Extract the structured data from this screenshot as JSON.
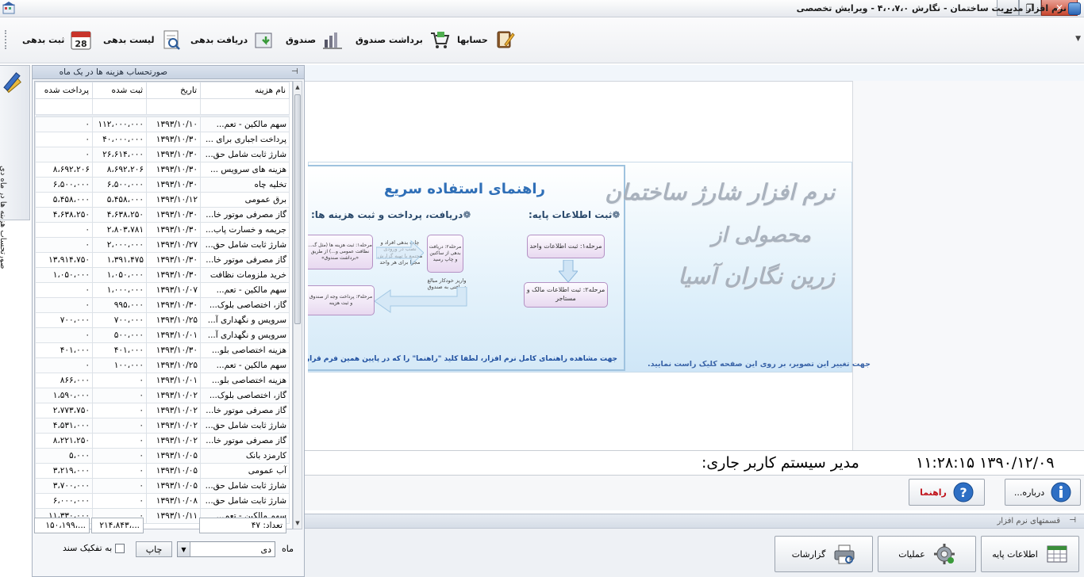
{
  "window": {
    "title": "نرم افزار مدیریت ساختمان - نگارش ۴،۰،۷،۰ - ویرایش تخصصی",
    "minimize": "▁",
    "maximize": "❐",
    "close": "✕"
  },
  "toolbar": {
    "items": [
      {
        "label": "حسابها",
        "icon": "accounts-book-icon"
      },
      {
        "label": "برداشت صندوق",
        "icon": "cash-withdraw-cart-icon"
      },
      {
        "label": "صندوق",
        "icon": "cash-box-chart-icon"
      },
      {
        "label": "دریافت بدهی",
        "icon": "receive-debt-icon"
      },
      {
        "label": "لیست بدهی",
        "icon": "debt-list-icon"
      },
      {
        "label": "ثبت بدهی",
        "icon": "calendar-28-icon",
        "badge": "28"
      }
    ]
  },
  "side_tab": {
    "label": "صورتحساب هزینه ها در ماه دی"
  },
  "panel": {
    "title": "صورتحساب هزینه ها در یک ماه",
    "pin": "⊣",
    "columns": [
      "نام هزینه",
      "تاریخ",
      "ثبت شده",
      "پرداخت شده"
    ],
    "rows": [
      {
        "name": "سهم مالکین - تعم...",
        "date": "۱۳۹۳/۱۰/۱۰",
        "registered": "۱۱۲،۰۰۰،۰۰۰",
        "paid": "۰"
      },
      {
        "name": "پرداخت اجباری برای ...",
        "date": "۱۳۹۳/۱۰/۳۰",
        "registered": "۴۰،۰۰۰،۰۰۰",
        "paid": "۰"
      },
      {
        "name": "شارژ ثابت شامل حق...",
        "date": "۱۳۹۳/۱۰/۳۰",
        "registered": "۲۶،۶۱۴،۰۰۰",
        "paid": "۰"
      },
      {
        "name": "هزینه های سرویس ...",
        "date": "۱۳۹۳/۱۰/۳۰",
        "registered": "۸،۶۹۲،۲۰۶",
        "paid": "۸،۶۹۲،۲۰۶"
      },
      {
        "name": "تخلیه چاه",
        "date": "۱۳۹۳/۱۰/۳۰",
        "registered": "۶،۵۰۰،۰۰۰",
        "paid": "۶،۵۰۰،۰۰۰"
      },
      {
        "name": "برق عمومی",
        "date": "۱۳۹۳/۱۰/۱۲",
        "registered": "۵،۴۵۸،۰۰۰",
        "paid": "۵،۴۵۸،۰۰۰"
      },
      {
        "name": "گاز مصرفی موتور خا...",
        "date": "۱۳۹۳/۱۰/۳۰",
        "registered": "۴،۶۳۸،۲۵۰",
        "paid": "۴،۶۳۸،۲۵۰"
      },
      {
        "name": "جریمه و خسارت پاب...",
        "date": "۱۳۹۳/۱۰/۳۰",
        "registered": "۲،۸۰۳،۷۸۱",
        "paid": "۰"
      },
      {
        "name": "شارژ ثابت شامل حق...",
        "date": "۱۳۹۳/۱۰/۲۷",
        "registered": "۲،۰۰۰،۰۰۰",
        "paid": "۰"
      },
      {
        "name": "گاز مصرفی موتور خا...",
        "date": "۱۳۹۳/۱۰/۳۰",
        "registered": "۱،۳۹۱،۴۷۵",
        "paid": "۱۳،۹۱۴،۷۵۰"
      },
      {
        "name": "خرید ملزومات نظافت",
        "date": "۱۳۹۳/۱۰/۳۰",
        "registered": "۱،۰۵۰،۰۰۰",
        "paid": "۱،۰۵۰،۰۰۰"
      },
      {
        "name": "سهم مالکین - تعم...",
        "date": "۱۳۹۳/۱۰/۰۷",
        "registered": "۱،۰۰۰،۰۰۰",
        "paid": "۰"
      },
      {
        "name": "گاز، اختصاصی بلوک...",
        "date": "۱۳۹۳/۱۰/۳۰",
        "registered": "۹۹۵،۰۰۰",
        "paid": "۰"
      },
      {
        "name": "سرویس و نگهداری آ...",
        "date": "۱۳۹۳/۱۰/۲۵",
        "registered": "۷۰۰،۰۰۰",
        "paid": "۷۰۰،۰۰۰"
      },
      {
        "name": "سرویس و نگهداری آ...",
        "date": "۱۳۹۳/۱۰/۰۱",
        "registered": "۵۰۰،۰۰۰",
        "paid": "۰"
      },
      {
        "name": "هزینه اختصاصی بلو...",
        "date": "۱۳۹۳/۱۰/۳۰",
        "registered": "۴۰۱،۰۰۰",
        "paid": "۴۰۱،۰۰۰"
      },
      {
        "name": "سهم مالکین - تعم...",
        "date": "۱۳۹۳/۱۰/۲۵",
        "registered": "۱۰۰،۰۰۰",
        "paid": "۰"
      },
      {
        "name": "هزینه اختصاصی بلو...",
        "date": "۱۳۹۳/۱۰/۰۱",
        "registered": "۰",
        "paid": "۸۶۶،۰۰۰"
      },
      {
        "name": "گاز، اختصاصی بلوک...",
        "date": "۱۳۹۳/۱۰/۰۲",
        "registered": "۰",
        "paid": "۱،۵۹۰،۰۰۰"
      },
      {
        "name": "گاز مصرفی موتور خا...",
        "date": "۱۳۹۳/۱۰/۰۲",
        "registered": "۰",
        "paid": "۲،۷۷۳،۷۵۰"
      },
      {
        "name": "شارژ ثابت شامل حق...",
        "date": "۱۳۹۳/۱۰/۰۲",
        "registered": "۰",
        "paid": "۴،۵۳۱،۰۰۰"
      },
      {
        "name": "گاز مصرفی موتور خا...",
        "date": "۱۳۹۳/۱۰/۰۲",
        "registered": "۰",
        "paid": "۸،۲۲۱،۲۵۰"
      },
      {
        "name": "کارمزد بانک",
        "date": "۱۳۹۳/۱۰/۰۵",
        "registered": "۰",
        "paid": "۵،۰۰۰"
      },
      {
        "name": "آب عمومی",
        "date": "۱۳۹۳/۱۰/۰۵",
        "registered": "۰",
        "paid": "۳،۲۱۹،۰۰۰"
      },
      {
        "name": "شارژ ثابت شامل حق...",
        "date": "۱۳۹۳/۱۰/۰۵",
        "registered": "۰",
        "paid": "۳،۷۰۰،۰۰۰"
      },
      {
        "name": "شارژ ثابت شامل حق...",
        "date": "۱۳۹۳/۱۰/۰۸",
        "registered": "۰",
        "paid": "۶،۰۰۰،۰۰۰"
      },
      {
        "name": "سهم مالکین - تعم...",
        "date": "۱۳۹۳/۱۰/۱۱",
        "registered": "۰",
        "paid": "۱۱،۳۳۰،۰۰۰"
      }
    ],
    "footer": {
      "count_label": "تعداد: ۴۷",
      "registered_total": "۲۱۴،۸۴۳،...",
      "paid_total": "۱۵۰،۱۹۹،..."
    },
    "month_label": "ماه",
    "month_value": "دی",
    "print_label": "چاپ",
    "separate_label": "به تفکیک سند"
  },
  "guide": {
    "title": "راهنمای استفاده سریع",
    "basic_heading": "❁ثبت اطلاعات پایه:",
    "flow_heading": "❁دریافت، پرداخت و ثبت هزینه ها:",
    "step1": "مرحله۱: ثبت اطلاعات واحد",
    "step2": "مرحله۲: ثبت اطلاعات مالک و مستاجر",
    "flow1": "مرحله۱: ثبت هزینه ها (مثل گ... نظافت عمومی و...) از طریق «برداشت صندوق»",
    "flow2": "مرحله۲: دریافت بدهی از ساکنین و چاپ رسید",
    "flow3": "مرحله۳: پرداخت وجه از صندوق و ثبت هزینه",
    "note1": "چاپ بدهی افراد و نصب در ورودی مجتمع یا تهیه گزارش مجزا برای هر واحد",
    "note2": "واریز خودکار مبالغ دریافتی به صندوق",
    "footer": "جهت مشاهده راهنمای کامل نرم افزار، لطفا کلید \"راهنما\" را که در پایین همین فرم قرار دارد، کلیک فرمایید"
  },
  "banner": {
    "line1": "نرم افزار شارژ ساختمان",
    "line2": "محصولی از",
    "line3": "زرین نگاران آسیا",
    "note": "جهت تغییر این تصویر، بر روی این صفحه کلیک راست نمایید."
  },
  "status": {
    "user_label": "کاربر جاری:",
    "user_name": "مدیر سیستم",
    "date": "۱۳۹۰/۱۲/۰۹",
    "time": "۱۱:۲۸:۱۵"
  },
  "buttons": {
    "about": "درباره...",
    "help": "راهنما"
  },
  "bottom_panel": {
    "title": "قسمتهای نرم افزار",
    "pin": "⊣",
    "base_info": "اطلاعات پایه",
    "operations": "عملیات",
    "reports": "گزارشات"
  },
  "colors": {
    "accent_blue": "#2f6fb7",
    "help_red": "#c0141c",
    "panel_header": "#c8d3e2"
  }
}
